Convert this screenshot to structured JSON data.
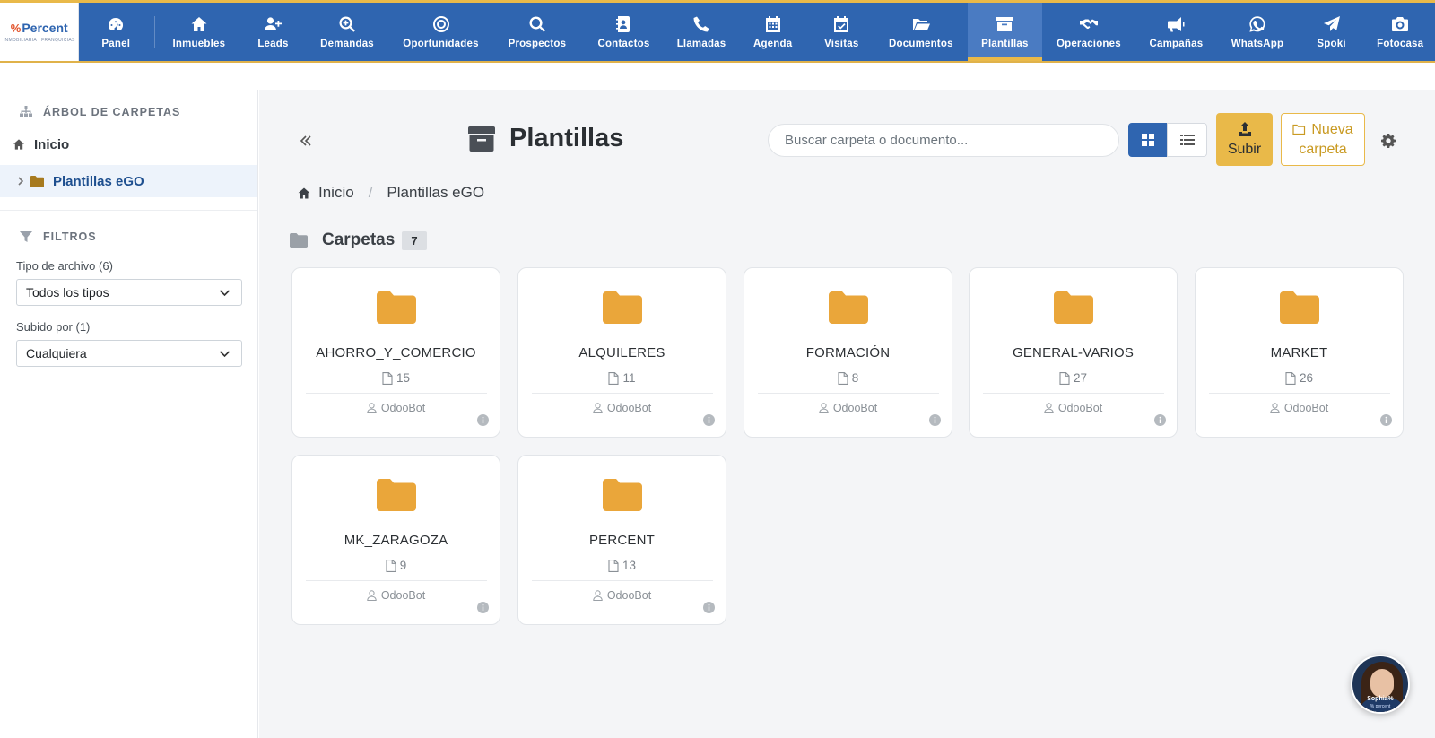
{
  "brand": {
    "mark": "%",
    "name": "Percent",
    "sub": "INMOBILIARIA · FRANQUICIAS"
  },
  "nav": [
    {
      "id": "panel",
      "label": "Panel",
      "icon": "dashboard-icon"
    },
    {
      "id": "inmuebles",
      "label": "Inmuebles",
      "icon": "home-icon"
    },
    {
      "id": "leads",
      "label": "Leads",
      "icon": "user-plus-icon"
    },
    {
      "id": "demandas",
      "label": "Demandas",
      "icon": "search-plus-icon"
    },
    {
      "id": "oportunidades",
      "label": "Oportunidades",
      "icon": "target-icon"
    },
    {
      "id": "prospectos",
      "label": "Prospectos",
      "icon": "search-icon"
    },
    {
      "id": "contactos",
      "label": "Contactos",
      "icon": "address-book-icon"
    },
    {
      "id": "llamadas",
      "label": "Llamadas",
      "icon": "phone-icon"
    },
    {
      "id": "agenda",
      "label": "Agenda",
      "icon": "calendar-icon"
    },
    {
      "id": "visitas",
      "label": "Visitas",
      "icon": "calendar-check-icon"
    },
    {
      "id": "documentos",
      "label": "Documentos",
      "icon": "folder-open-icon"
    },
    {
      "id": "plantillas",
      "label": "Plantillas",
      "icon": "archive-icon",
      "active": true
    },
    {
      "id": "operaciones",
      "label": "Operaciones",
      "icon": "handshake-icon"
    },
    {
      "id": "campanas",
      "label": "Campañas",
      "icon": "megaphone-icon"
    },
    {
      "id": "whatsapp",
      "label": "WhatsApp",
      "icon": "whatsapp-icon"
    },
    {
      "id": "spoki",
      "label": "Spoki",
      "icon": "paper-plane-icon"
    },
    {
      "id": "fotocasa",
      "label": "Fotocasa",
      "icon": "camera-icon"
    }
  ],
  "sidebar": {
    "tree_title": "ÁRBOL DE CARPETAS",
    "root": "Inicio",
    "child": "Plantillas eGO",
    "filters_title": "FILTROS",
    "file_type_label": "Tipo de archivo (6)",
    "file_type_value": "Todos los tipos",
    "uploaded_by_label": "Subido por (1)",
    "uploaded_by_value": "Cualquiera"
  },
  "header": {
    "title": "Plantillas",
    "search_placeholder": "Buscar carpeta o documento...",
    "upload": "Subir",
    "new_folder_1": "Nueva",
    "new_folder_2": "carpeta"
  },
  "breadcrumb": {
    "home": "Inicio",
    "sep": "/",
    "current": "Plantillas eGO"
  },
  "section": {
    "title": "Carpetas",
    "count": "7"
  },
  "folders": [
    {
      "name": "AHORRO_Y_COMERCIO",
      "docs": "15",
      "owner": "OdooBot"
    },
    {
      "name": "ALQUILERES",
      "docs": "11",
      "owner": "OdooBot"
    },
    {
      "name": "FORMACIÓN",
      "docs": "8",
      "owner": "OdooBot"
    },
    {
      "name": "GENERAL-VARIOS",
      "docs": "27",
      "owner": "OdooBot"
    },
    {
      "name": "MARKET",
      "docs": "26",
      "owner": "OdooBot"
    },
    {
      "name": "MK_ZARAGOZA",
      "docs": "9",
      "owner": "OdooBot"
    },
    {
      "name": "PERCENT",
      "docs": "13",
      "owner": "OdooBot"
    }
  ],
  "assistant": {
    "name": "Sophia%",
    "brand": "% percent"
  },
  "colors": {
    "primary": "#2f65b0",
    "accent": "#e9b949",
    "folder": "#eaa63a"
  }
}
